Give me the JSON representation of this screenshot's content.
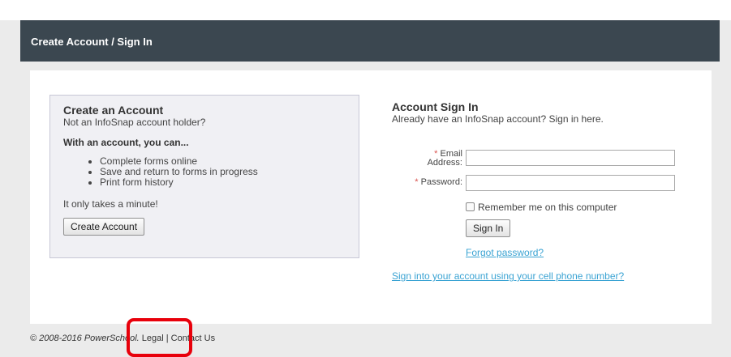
{
  "header": {
    "title": "Create Account / Sign In"
  },
  "create": {
    "title": "Create an Account",
    "subtitle": "Not an InfoSnap account holder?",
    "with_title": "With an account, you can...",
    "benefits": [
      "Complete forms online",
      "Save and return to forms in progress",
      "Print form history"
    ],
    "minute_text": "It only takes a minute!",
    "button_label": "Create Account"
  },
  "signin": {
    "title": "Account Sign In",
    "subtitle": "Already have an InfoSnap account? Sign in here.",
    "required_mark": "*",
    "email_label_line1": "Email",
    "email_label_line2": "Address:",
    "email_value": "",
    "password_label": "Password:",
    "password_value": "",
    "remember_label": "Remember me on this computer",
    "remember_checked": false,
    "button_label": "Sign In",
    "forgot_link": "Forgot password?",
    "cell_link": "Sign into your account using your cell phone number?"
  },
  "footer": {
    "copyright": "© 2008-2016 PowerSchool.",
    "legal_link": "Legal",
    "separator": "|",
    "contact_link": "Contact Us"
  },
  "colors": {
    "header_bg": "#3b4750",
    "link": "#3aa3d3",
    "required": "#d9534f",
    "highlight": "#e8000b"
  }
}
